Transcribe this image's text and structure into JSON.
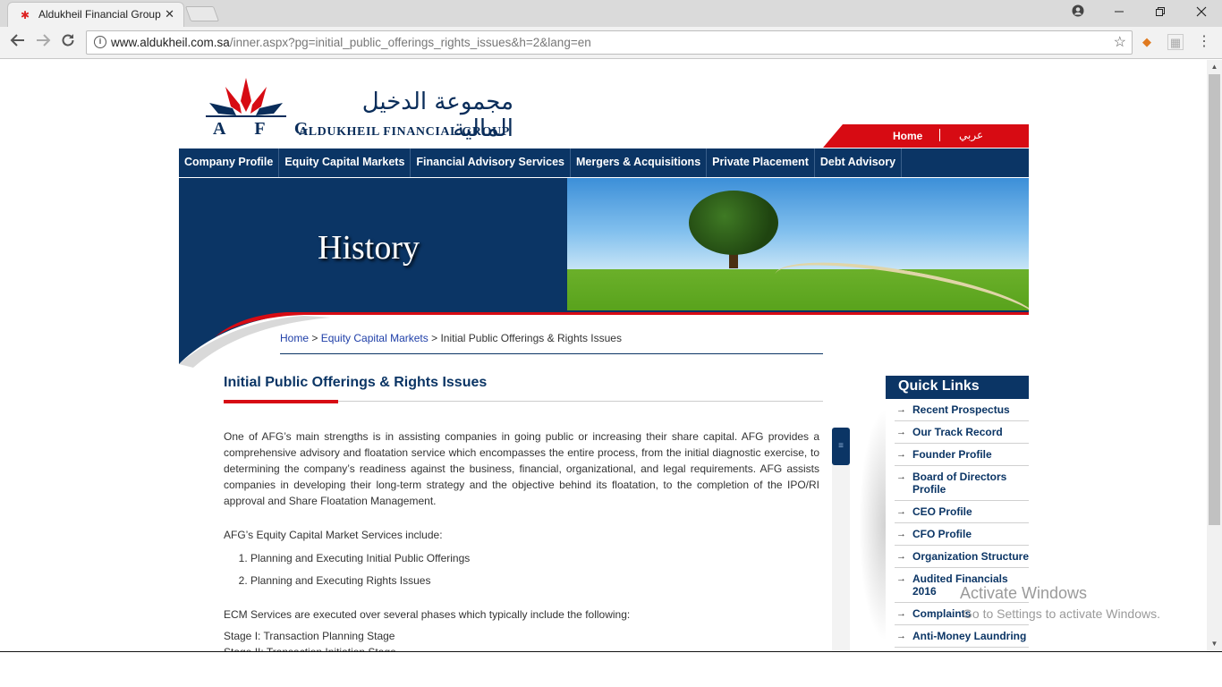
{
  "browser": {
    "tab_title": "Aldukheil Financial Group",
    "tab_close": "✕",
    "url_domain": "www.aldukheil.com.sa",
    "url_path": "/inner.aspx?pg=initial_public_offerings_rights_issues&h=2&lang=en"
  },
  "site": {
    "logo_letters": "A F G",
    "logo_arabic": "مجموعة الدخيل المالية",
    "logo_english": "ALDUKHEIL FINANCIAL GROUP",
    "top_home": "Home",
    "top_arabic": "عربي"
  },
  "nav": {
    "items": [
      "Company Profile",
      "Equity Capital Markets",
      "Financial Advisory Services",
      "Mergers & Acquisitions",
      "Private Placement",
      "Debt Advisory"
    ]
  },
  "banner": {
    "heading": "History"
  },
  "breadcrumb": {
    "home": "Home",
    "sep1": " > ",
    "section": "Equity Capital Markets",
    "sep2": " > ",
    "current": "Initial Public Offerings & Rights Issues"
  },
  "content": {
    "title": "Initial Public Offerings & Rights Issues",
    "para1": "One of AFG’s main strengths is in assisting companies in going public or increasing their share capital. AFG provides a comprehensive advisory and floatation service which encompasses the entire process, from the initial diagnostic exercise, to determining the company’s readiness against the business, financial, organizational, and legal requirements. AFG assists companies in developing their long-term strategy and the objective behind its floatation, to the completion of the IPO/RI approval and Share Floatation Management.",
    "para2": "AFG’s Equity Capital Market Services include:",
    "list": [
      "Planning and Executing Initial Public Offerings",
      "Planning and Executing Rights Issues"
    ],
    "para3": "ECM Services are executed over several phases which typically include the following:",
    "stage1": "Stage I: Transaction Planning Stage",
    "stage2": "Stage II: Transaction Initiation Stage"
  },
  "quicklinks": {
    "heading": "Quick Links",
    "items": [
      "Recent Prospectus",
      "Our Track Record",
      "Founder Profile",
      "Board of Directors Profile",
      "CEO Profile",
      "CFO Profile",
      "Organization Structure",
      "Audited Financials 2016",
      "Complaints",
      "Anti-Money Laundring"
    ]
  },
  "watermark": {
    "line1": "Activate Windows",
    "line2": "Go to Settings to activate Windows."
  },
  "colors": {
    "navy": "#0b3565",
    "red": "#d70b13"
  }
}
